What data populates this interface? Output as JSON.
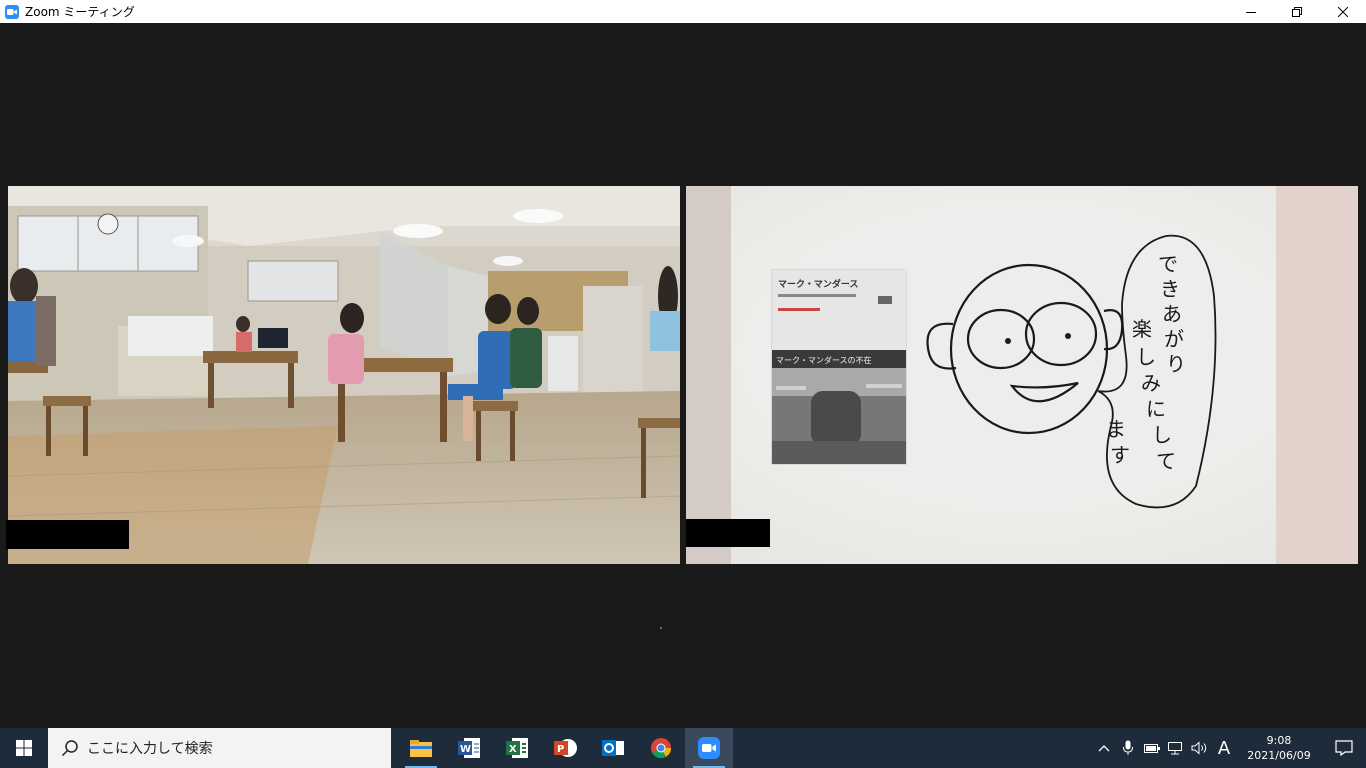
{
  "window": {
    "title": "Zoom ミーティング",
    "controls": [
      "minimize",
      "restore",
      "close"
    ]
  },
  "meeting": {
    "participants": [
      {
        "video": "classroom-with-students",
        "name_hidden": true
      },
      {
        "video": "poster-and-drawing",
        "name_hidden": true
      }
    ],
    "poster": {
      "title": "マーク・マンダース",
      "subtitle": "マーク・マンダースの不在"
    },
    "drawing_text": "できあがり楽しみにしてます"
  },
  "taskbar": {
    "search_placeholder": "ここに入力して検索",
    "apps": [
      "file-explorer",
      "word",
      "excel",
      "powerpoint",
      "outlook",
      "chrome",
      "zoom"
    ],
    "ime_mode": "A",
    "time": "9:08",
    "date": "2021/06/09"
  },
  "colors": {
    "meeting_bg": "#1a1a1a",
    "taskbar_bg": "#1d2b3a",
    "zoom_blue": "#2d8cff"
  }
}
